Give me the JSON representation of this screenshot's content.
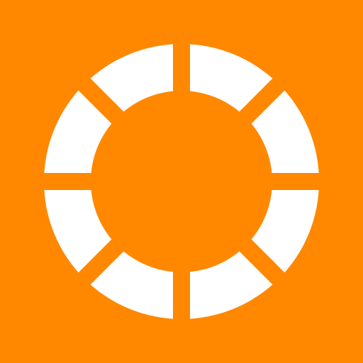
{
  "icon": {
    "name": "segmented-ring-icon",
    "background_color": "#FF8800",
    "foreground_color": "#FFFFFF",
    "segment_count": 8
  }
}
